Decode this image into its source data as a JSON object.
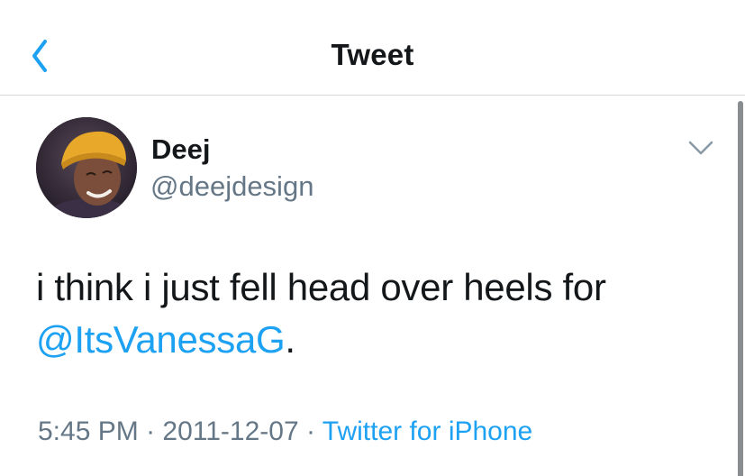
{
  "header": {
    "title": "Tweet",
    "back_icon": "chevron-left-icon"
  },
  "author": {
    "name": "Deej",
    "handle": "@deejdesign",
    "menu_icon": "chevron-down-icon"
  },
  "tweet": {
    "text": "i think i just fell head over heels for ",
    "mention": "@ItsVanessaG",
    "text_end": "."
  },
  "meta": {
    "time": "5:45 PM",
    "separator": "·",
    "date": "2011-12-07",
    "source": "Twitter for iPhone"
  },
  "colors": {
    "accent": "#1da1f2",
    "text": "#14171a",
    "secondary": "#657786",
    "divider": "#d6d9dc"
  }
}
